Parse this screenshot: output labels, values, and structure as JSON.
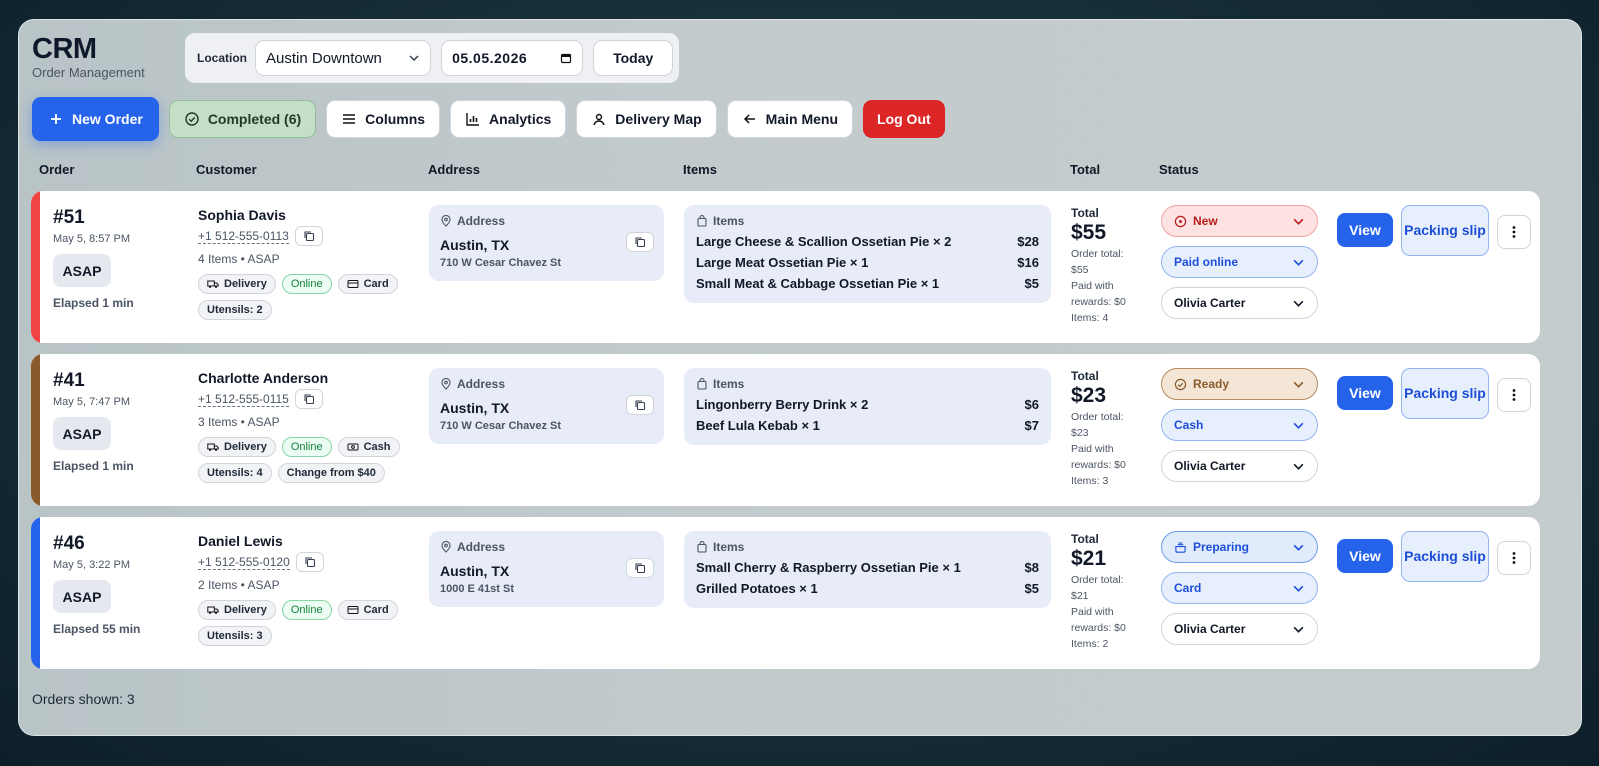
{
  "brand": {
    "title": "CRM",
    "subtitle": "Order Management"
  },
  "filters": {
    "location_label": "Location",
    "location_value": "Austin Downtown",
    "date_value": "05.05.2026",
    "today_label": "Today"
  },
  "toolbar": {
    "new_order": "New Order",
    "completed": "Completed (6)",
    "columns": "Columns",
    "analytics": "Analytics",
    "delivery_map": "Delivery Map",
    "main_menu": "Main Menu",
    "log_out": "Log Out"
  },
  "columns": {
    "order": "Order",
    "customer": "Customer",
    "address": "Address",
    "items": "Items",
    "total": "Total",
    "status": "Status"
  },
  "orders": [
    {
      "number": "#51",
      "date": "May 5, 8:57 PM",
      "badge": "ASAP",
      "elapsed": "Elapsed 1 min",
      "accent": "#ef4444",
      "customer": "Sophia Davis",
      "phone": "+1 512-555-0113",
      "meta": "4 Items • ASAP",
      "chips": [
        "Delivery",
        "Online",
        "Card",
        "Utensils: 2"
      ],
      "address_label": "Address",
      "city": "Austin, TX",
      "street": "710 W Cesar Chavez St",
      "items_label": "Items",
      "items": [
        {
          "name": "Large Cheese & Scallion Ossetian Pie × 2",
          "price": "$28"
        },
        {
          "name": "Large Meat Ossetian Pie × 1",
          "price": "$16"
        },
        {
          "name": "Small Meat & Cabbage Ossetian Pie × 1",
          "price": "$5"
        }
      ],
      "total_label": "Total",
      "total": "$55",
      "total_meta": [
        "Order total:",
        "$55",
        "Paid with",
        "rewards: $0",
        "Items: 4"
      ],
      "status": "New",
      "payment": "Paid online",
      "courier": "Olivia Carter",
      "view": "View",
      "slip": "Packing slip"
    },
    {
      "number": "#41",
      "date": "May 5, 7:47 PM",
      "badge": "ASAP",
      "elapsed": "Elapsed 1 min",
      "accent": "#8a5a2b",
      "customer": "Charlotte Anderson",
      "phone": "+1 512-555-0115",
      "meta": "3 Items • ASAP",
      "chips": [
        "Delivery",
        "Online",
        "Cash",
        "Utensils: 4",
        "Change from $40"
      ],
      "address_label": "Address",
      "city": "Austin, TX",
      "street": "710 W Cesar Chavez St",
      "items_label": "Items",
      "items": [
        {
          "name": "Lingonberry Berry Drink × 2",
          "price": "$6"
        },
        {
          "name": "Beef Lula Kebab × 1",
          "price": "$7"
        }
      ],
      "total_label": "Total",
      "total": "$23",
      "total_meta": [
        "Order total:",
        "$23",
        "Paid with",
        "rewards: $0",
        "Items: 3"
      ],
      "status": "Ready",
      "payment": "Cash",
      "courier": "Olivia Carter",
      "view": "View",
      "slip": "Packing slip"
    },
    {
      "number": "#46",
      "date": "May 5, 3:22 PM",
      "badge": "ASAP",
      "elapsed": "Elapsed 55 min",
      "accent": "#2563eb",
      "customer": "Daniel Lewis",
      "phone": "+1 512-555-0120",
      "meta": "2 Items • ASAP",
      "chips": [
        "Delivery",
        "Online",
        "Card",
        "Utensils: 3"
      ],
      "address_label": "Address",
      "city": "Austin, TX",
      "street": "1000 E 41st St",
      "items_label": "Items",
      "items": [
        {
          "name": "Small Cherry & Raspberry Ossetian Pie × 1",
          "price": "$8"
        },
        {
          "name": "Grilled Potatoes × 1",
          "price": "$5"
        }
      ],
      "total_label": "Total",
      "total": "$21",
      "total_meta": [
        "Order total:",
        "$21",
        "Paid with",
        "rewards: $0",
        "Items: 2"
      ],
      "status": "Preparing",
      "payment": "Card",
      "courier": "Olivia Carter",
      "view": "View",
      "slip": "Packing slip"
    }
  ],
  "footer": {
    "orders_shown": "Orders shown: 3"
  },
  "colors": {
    "primary": "#2563eb",
    "danger": "#dc2626",
    "new_bg": "#fde2e2",
    "new_fg": "#b91c1c",
    "ready_bg": "#f3e6d6",
    "ready_fg": "#8a5a2b",
    "preparing_bg": "#e0ecfc",
    "preparing_fg": "#1d4ed8"
  }
}
